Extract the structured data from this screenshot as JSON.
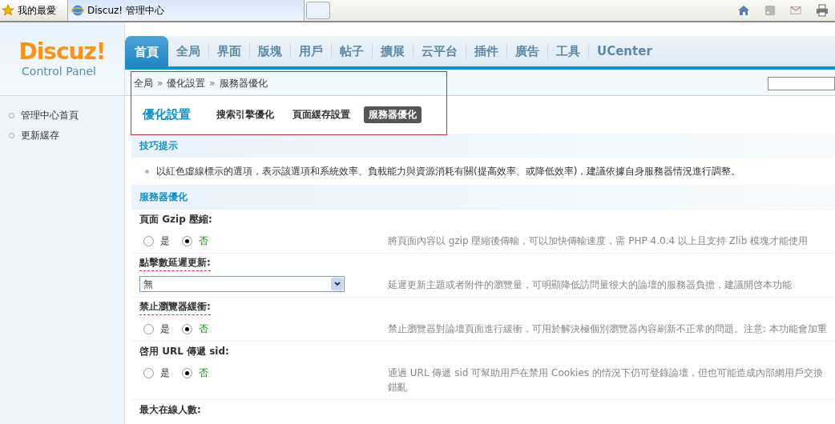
{
  "browser": {
    "favorites": "我的最愛",
    "tab_title": "Discuz! 管理中心"
  },
  "logo": {
    "name": "Discuz!",
    "subtitle": "Control Panel"
  },
  "nav": [
    {
      "label": "首頁",
      "selected": true
    },
    {
      "label": "全局",
      "selected": false
    },
    {
      "label": "界面",
      "selected": false
    },
    {
      "label": "版塊",
      "selected": false
    },
    {
      "label": "用戶",
      "selected": false
    },
    {
      "label": "帖子",
      "selected": false
    },
    {
      "label": "擴展",
      "selected": false
    },
    {
      "label": "云平台",
      "selected": false
    },
    {
      "label": "插件",
      "selected": false
    },
    {
      "label": "廣告",
      "selected": false
    },
    {
      "label": "工具",
      "selected": false
    },
    {
      "label": "UCenter",
      "selected": false
    }
  ],
  "sidebar": {
    "items": [
      "管理中心首頁",
      "更新緩存"
    ]
  },
  "breadcrumb": {
    "items": [
      "全局",
      "優化設置",
      "服務器優化"
    ],
    "separator": "»"
  },
  "subtabs": {
    "title": "優化設置",
    "items": [
      {
        "label": "搜索引擎優化",
        "selected": false
      },
      {
        "label": "頁面緩存設置",
        "selected": false
      },
      {
        "label": "服務器優化",
        "selected": true
      }
    ]
  },
  "tips": {
    "title": "技巧提示",
    "text": "以紅色虛線標示的選項，表示該選項和系統效率、負載能力與資源消耗有關(提高效率、或降低效率)，建議依據自身服務器情況進行調整。"
  },
  "section": {
    "title": "服務器優化",
    "fields": [
      {
        "label": "頁面 Gzip 壓縮:",
        "performance": false,
        "kind": "radio",
        "options": [
          {
            "label": "是",
            "selected": false
          },
          {
            "label": "否",
            "selected": true
          }
        ],
        "description": "將頁面內容以 gzip 壓縮後傳輸，可以加快傳輸速度，需 PHP 4.0.4 以上且支持 Zlib 模塊才能使用"
      },
      {
        "label": "點擊數延遲更新:",
        "performance": true,
        "kind": "select",
        "value": "無",
        "description": "延遲更新主題或者附件的瀏覽量，可明顯降低訪問量很大的論壇的服務器負擔，建議開啓本功能"
      },
      {
        "label": "禁止瀏覽器緩衝:",
        "performance": true,
        "kind": "radio",
        "options": [
          {
            "label": "是",
            "selected": false
          },
          {
            "label": "否",
            "selected": true
          }
        ],
        "description": "禁止瀏覽器對論壇頁面進行緩衝，可用於解決極個別瀏覽器內容刷新不正常的問題。注意: 本功能會加重"
      },
      {
        "label": "啓用 URL 傳遞 sid:",
        "performance": false,
        "kind": "radio",
        "options": [
          {
            "label": "是",
            "selected": false
          },
          {
            "label": "否",
            "selected": true
          }
        ],
        "description": "通過 URL 傳遞 sid 可幫助用戶在禁用 Cookies 的情況下仍可登錄論壇，但也可能造成內部網用戶交換錯亂"
      },
      {
        "label": "最大在線人數:",
        "performance": false,
        "kind": "heading"
      }
    ]
  }
}
